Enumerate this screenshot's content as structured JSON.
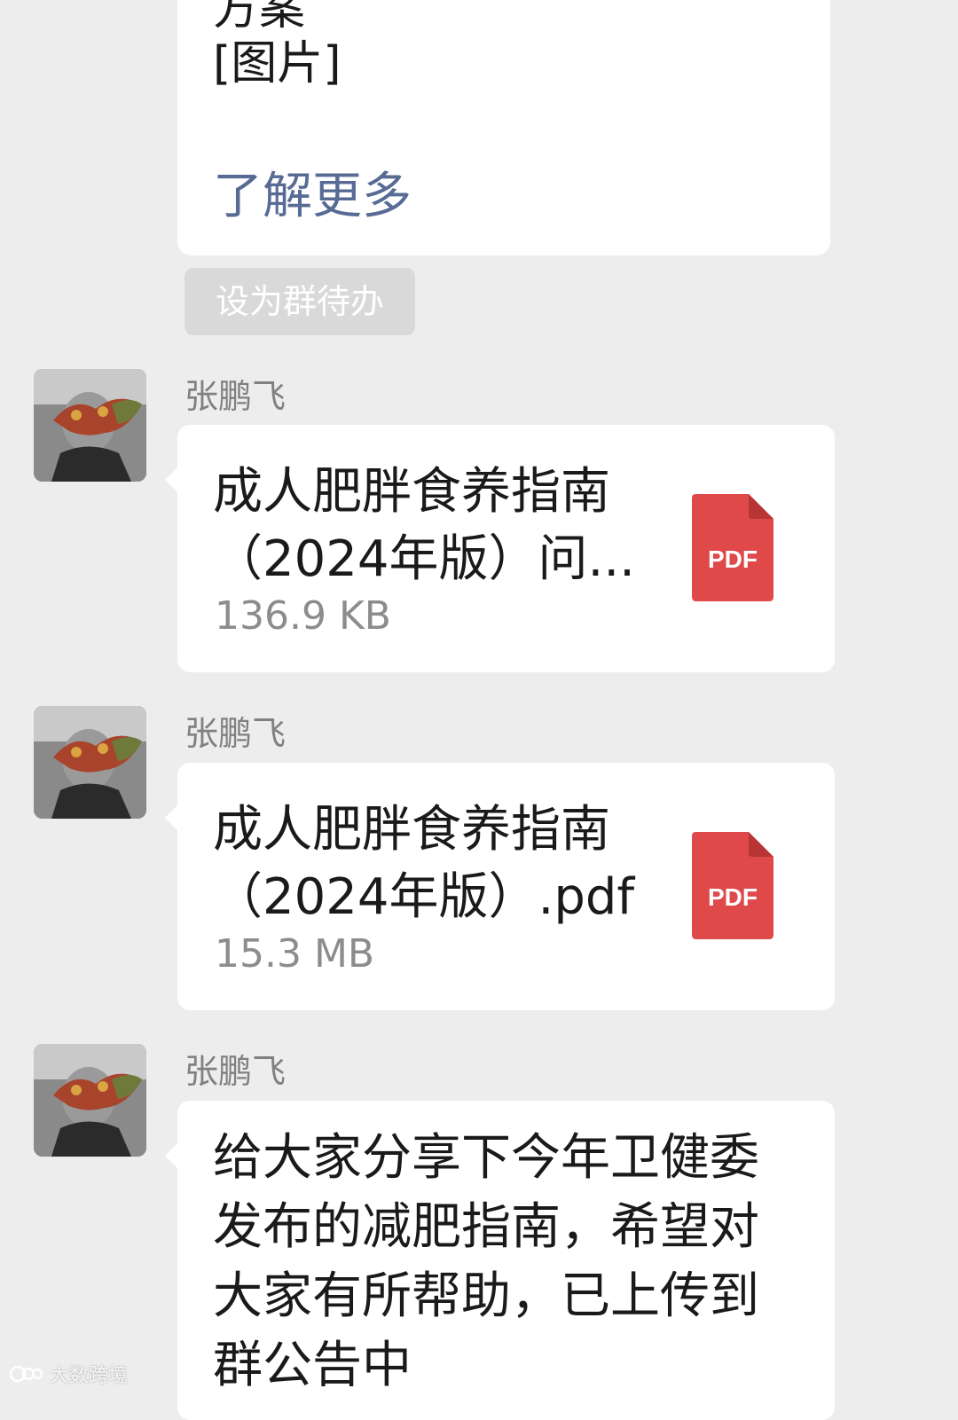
{
  "top_card": {
    "line1": "方案",
    "line2": "[图片]",
    "learn_more": "了解更多"
  },
  "todo_button": "设为群待办",
  "messages": [
    {
      "sender": "张鹏飞",
      "type": "file",
      "file_name": "成人肥胖食养指南（2024年版）问...",
      "file_size": "136.9 KB",
      "file_icon": "pdf-icon",
      "file_icon_label": "PDF"
    },
    {
      "sender": "张鹏飞",
      "type": "file",
      "file_name": "成人肥胖食养指南（2024年版）.pdf",
      "file_size": "15.3 MB",
      "file_icon": "pdf-icon",
      "file_icon_label": "PDF"
    },
    {
      "sender": "张鹏飞",
      "type": "text",
      "text": "给大家分享下今年卫健委发布的减肥指南，希望对大家有所帮助，已上传到群公告中"
    }
  ],
  "watermark": "大数跨境",
  "colors": {
    "background": "#ededed",
    "bubble": "#ffffff",
    "link": "#576b95",
    "pdf_red": "#e0494a",
    "muted_text": "#808080"
  }
}
